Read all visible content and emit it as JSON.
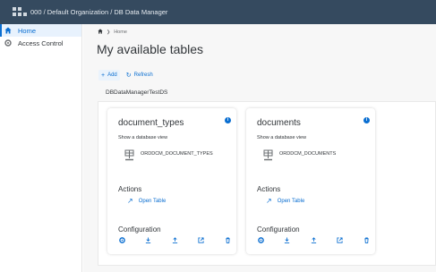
{
  "topbar": {
    "title": "000 / Default Organization / DB Data Manager"
  },
  "sidebar": {
    "items": [
      {
        "label": "Home",
        "icon": "home-icon",
        "active": true
      },
      {
        "label": "Access Control",
        "icon": "settings-icon",
        "active": false
      }
    ]
  },
  "breadcrumb": {
    "label": "Home"
  },
  "page": {
    "title": "My available tables"
  },
  "toolbar": {
    "add_label": "Add",
    "refresh_label": "Refresh"
  },
  "datasource": {
    "label": "DBDataManagerTestDS"
  },
  "cards": [
    {
      "title": "document_types",
      "subtitle": "Show a database view",
      "view_name": "ORDDCM_DOCUMENT_TYPES",
      "actions_label": "Actions",
      "open_label": "Open Table",
      "config_label": "Configuration"
    },
    {
      "title": "documents",
      "subtitle": "Show a database view",
      "view_name": "ORDDCM_DOCUMENTS",
      "actions_label": "Actions",
      "open_label": "Open Table",
      "config_label": "Configuration"
    }
  ],
  "colors": {
    "accent": "#0a6ed1",
    "shell": "#354a5f",
    "info": "#0a6ed1"
  }
}
